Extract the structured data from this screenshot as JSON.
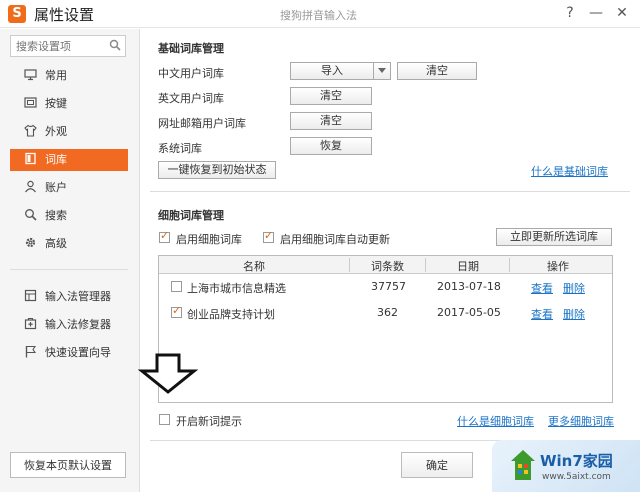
{
  "window": {
    "app_title": "属性设置",
    "subtitle": "搜狗拼音输入法",
    "logo_letter": "S",
    "help": "?",
    "minimize": "—",
    "close": "✕"
  },
  "sidebar": {
    "search_placeholder": "搜索设置项",
    "items": [
      {
        "label": "常用",
        "icon": "monitor-icon"
      },
      {
        "label": "按键",
        "icon": "keyboard-icon"
      },
      {
        "label": "外观",
        "icon": "shirt-icon"
      },
      {
        "label": "词库",
        "icon": "book-icon",
        "active": true
      },
      {
        "label": "账户",
        "icon": "user-icon"
      },
      {
        "label": "搜索",
        "icon": "search-icon"
      },
      {
        "label": "高级",
        "icon": "gear-icon"
      }
    ],
    "tools": [
      {
        "label": "输入法管理器",
        "icon": "manager-icon"
      },
      {
        "label": "输入法修复器",
        "icon": "repair-icon"
      },
      {
        "label": "快速设置向导",
        "icon": "flag-icon"
      }
    ],
    "restore_label": "恢复本页默认设置"
  },
  "basic": {
    "title": "基础词库管理",
    "rows": [
      {
        "label": "中文用户词库",
        "btn1": "导入",
        "btn2": "清空"
      },
      {
        "label": "英文用户词库",
        "btn1": "清空"
      },
      {
        "label": "网址邮箱用户词库",
        "btn1": "清空"
      },
      {
        "label": "系统词库",
        "btn1": "恢复"
      }
    ],
    "reset_label": "一键恢复到初始状态",
    "what_link": "什么是基础词库"
  },
  "cell": {
    "title": "细胞词库管理",
    "enable_label": "启用细胞词库",
    "auto_update_label": "启用细胞词库自动更新",
    "update_now": "立即更新所选词库",
    "columns": [
      "名称",
      "词条数",
      "日期",
      "操作"
    ],
    "rows": [
      {
        "name": "上海市城市信息精选",
        "count": "37757",
        "date": "2013-07-18",
        "view": "查看",
        "del": "删除",
        "checked": false
      },
      {
        "name": "创业品牌支持计划",
        "count": "362",
        "date": "2017-05-05",
        "view": "查看",
        "del": "删除",
        "checked": true
      }
    ],
    "new_word_tip": "开启新词提示",
    "what_link": "什么是细胞词库",
    "more_link": "更多细胞词库"
  },
  "footer": {
    "ok_label": "确定"
  },
  "watermark": {
    "title": "Win7家园",
    "url": "www.5aixt.com"
  },
  "colors": {
    "accent": "#f26a21",
    "link": "#1a73c7"
  }
}
